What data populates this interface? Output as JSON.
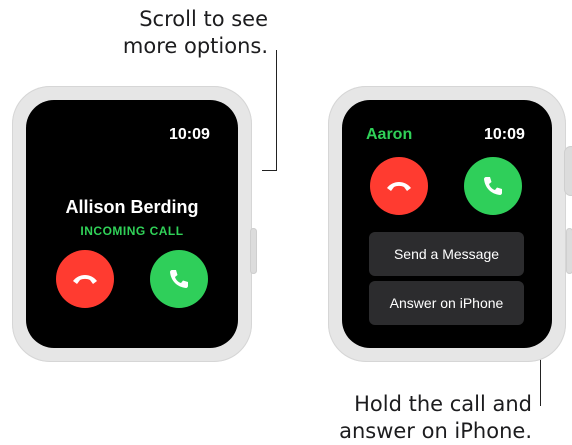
{
  "callouts": {
    "scroll_line1": "Scroll to see",
    "scroll_line2": "more options.",
    "hold_line1": "Hold the call and",
    "hold_line2": "answer on iPhone."
  },
  "watch_left": {
    "time": "10:09",
    "caller_name": "Allison Berding",
    "status": "INCOMING CALL",
    "decline_icon": "phone-hangup-icon",
    "accept_icon": "phone-icon"
  },
  "watch_right": {
    "caller_name": "Aaron",
    "time": "10:09",
    "decline_icon": "phone-hangup-icon",
    "accept_icon": "phone-icon",
    "options": [
      "Send a Message",
      "Answer on iPhone"
    ]
  },
  "colors": {
    "accent_green": "#30d158",
    "decline_red": "#ff3b30",
    "accept_green": "#2fcf5a",
    "option_bg": "#2c2c2e"
  }
}
